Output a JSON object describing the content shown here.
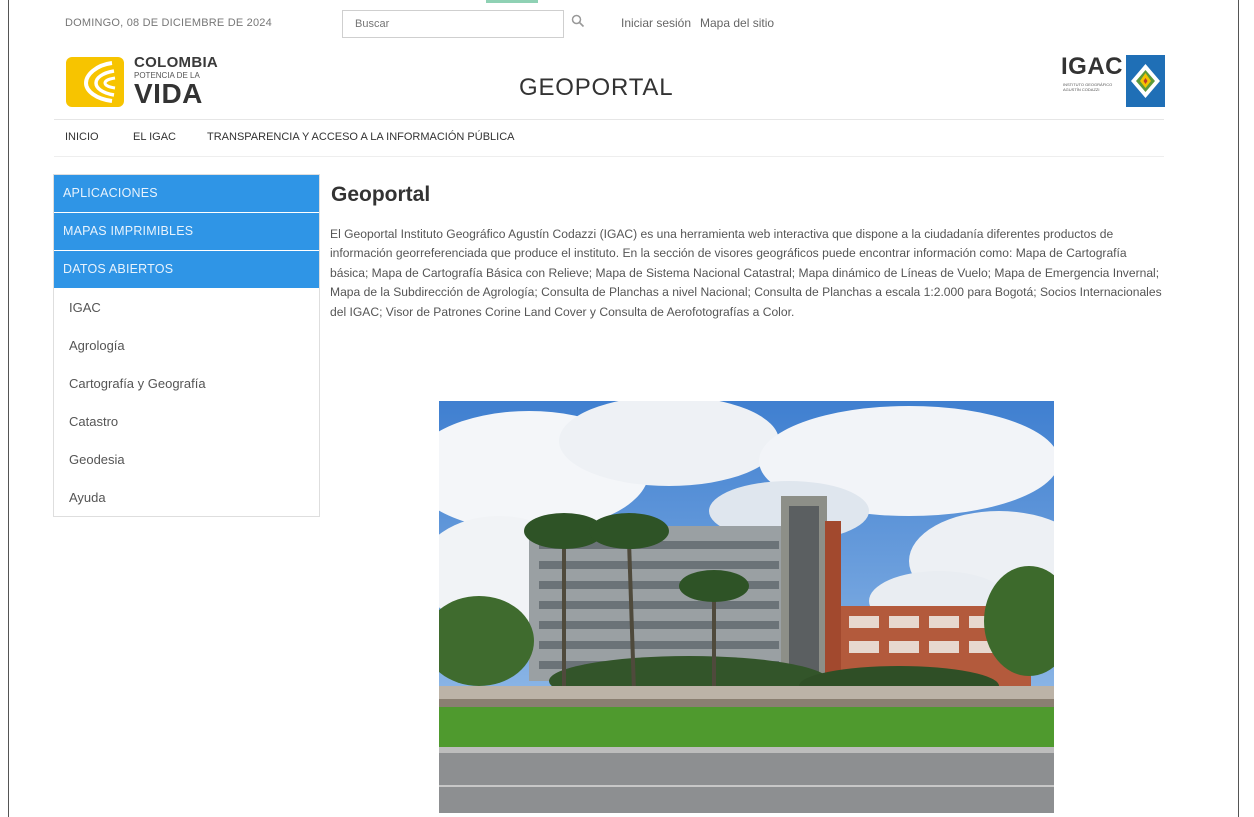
{
  "topbar": {
    "date": "DOMINGO, 08 DE DICIEMBRE DE 2024",
    "search_placeholder": "Buscar",
    "search_icon": "magnifier-icon",
    "login_label": "Iniciar sesión",
    "sitemap_label": "Mapa del sitio"
  },
  "branding": {
    "colombia_logo": {
      "title": "COLOMBIA",
      "subtitle": "POTENCIA DE LA",
      "word": "VIDA"
    },
    "site_title": "GEOPORTAL",
    "igac_logo": {
      "text": "IGAC",
      "subtext": "INSTITUTO GEOGRÁFICO AGUSTÍN CODAZZI"
    }
  },
  "nav": {
    "items": [
      {
        "label": "INICIO"
      },
      {
        "label": "EL IGAC"
      },
      {
        "label": "TRANSPARENCIA Y ACCESO A LA INFORMACIÓN PÚBLICA"
      }
    ]
  },
  "sidebar": {
    "highlighted": [
      {
        "label": "APLICACIONES"
      },
      {
        "label": "MAPAS IMPRIMIBLES"
      },
      {
        "label": "DATOS ABIERTOS"
      }
    ],
    "links": [
      {
        "label": "IGAC"
      },
      {
        "label": "Agrología"
      },
      {
        "label": "Cartografía y Geografía"
      },
      {
        "label": "Catastro"
      },
      {
        "label": "Geodesia"
      },
      {
        "label": "Ayuda"
      }
    ]
  },
  "main": {
    "heading": "Geoportal",
    "intro": "El Geoportal Instituto Geográfico Agustín Codazzi (IGAC) es una herramienta web interactiva que dispone a la ciudadanía diferentes productos de información georreferenciada que produce el instituto. En la sección de visores geográficos puede encontrar información como: Mapa de Cartografía básica; Mapa de Cartografía Básica con Relieve; Mapa de Sistema Nacional Catastral; Mapa dinámico de Líneas de Vuelo; Mapa de Emergencia Invernal; Mapa de la Subdirección de Agrología; Consulta de Planchas a nivel Nacional; Consulta de Planchas a escala 1:2.000 para Bogotá; Socios Internacionales del IGAC; Visor de Patrones Corine Land Cover y Consulta de Aerofotografías a Color."
  },
  "colors": {
    "sidebar_blue": "#2f95e6",
    "logo_yellow": "#f7c400",
    "igac_blue": "#1f6fb6"
  }
}
